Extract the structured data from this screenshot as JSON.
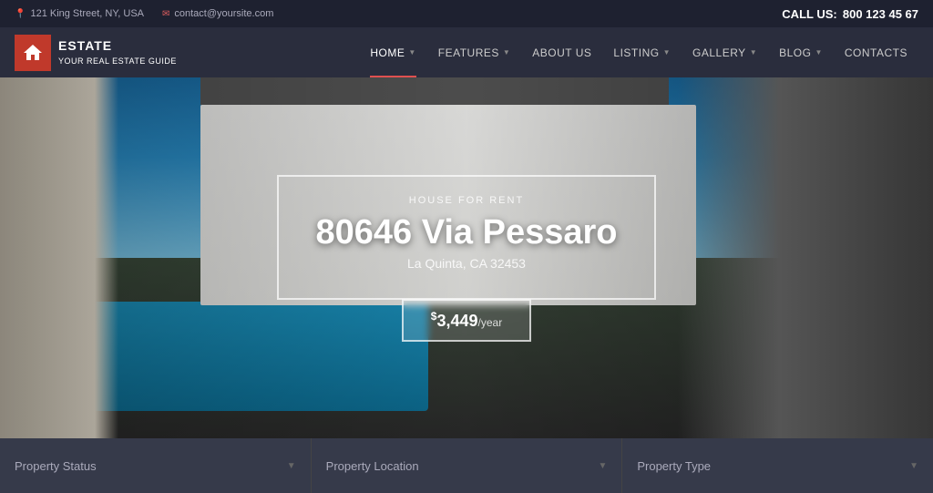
{
  "topbar": {
    "address_icon": "📍",
    "address": "121 King Street, NY, USA",
    "email_icon": "✉",
    "email": "contact@yoursite.com",
    "call_label": "CALL US:",
    "phone": "800 123 45 67"
  },
  "logo": {
    "name": "ESTATE",
    "tagline": "YOUR REAL ESTATE GUIDE"
  },
  "nav": {
    "items": [
      {
        "label": "HOME",
        "has_arrow": true,
        "active": true
      },
      {
        "label": "FEATURES",
        "has_arrow": true,
        "active": false
      },
      {
        "label": "ABOUT US",
        "has_arrow": false,
        "active": false
      },
      {
        "label": "LISTING",
        "has_arrow": true,
        "active": false
      },
      {
        "label": "GALLERY",
        "has_arrow": true,
        "active": false
      },
      {
        "label": "BLOG",
        "has_arrow": true,
        "active": false
      },
      {
        "label": "CONTACTS",
        "has_arrow": false,
        "active": false
      }
    ]
  },
  "hero": {
    "tag": "HOUSE FOR RENT",
    "title": "80646 Via Pessaro",
    "subtitle": "La Quinta, CA 32453",
    "price": "3,449",
    "price_period": "/year"
  },
  "search": {
    "status_label": "Property Status",
    "location_label": "Property Location",
    "type_label": "Property Type"
  }
}
